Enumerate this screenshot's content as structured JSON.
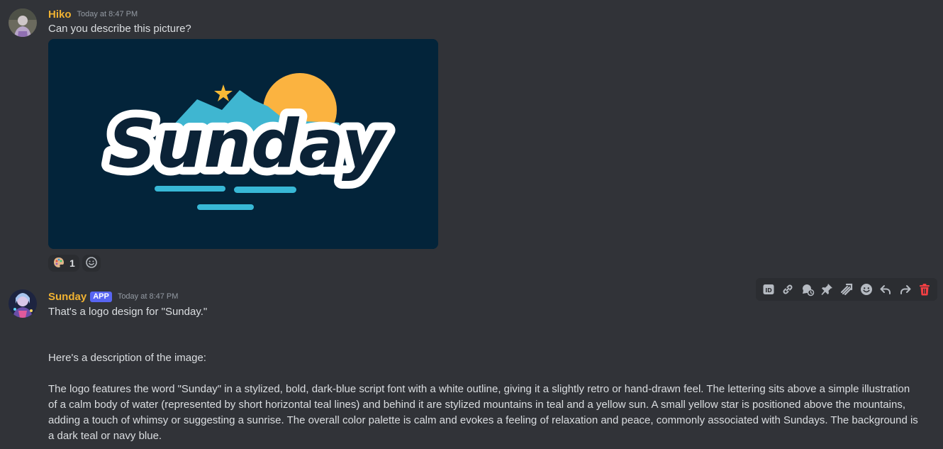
{
  "messages": [
    {
      "author": "Hiko",
      "timestamp": "Today at 8:47 PM",
      "text": "Can you describe this picture?",
      "attachment": {
        "word": "Sunday",
        "colors": {
          "background": "#03243a",
          "sun": "#fbb340",
          "mountain": "#3fb6d1",
          "star": "#f5b936",
          "water": "#38b8d6",
          "letter": "#0b2236",
          "outline": "#ffffff"
        }
      },
      "reactions": [
        {
          "emoji": "palette-icon",
          "count": "1"
        }
      ]
    },
    {
      "author": "Sunday",
      "badge": "APP",
      "timestamp": "Today at 8:47 PM",
      "lines": [
        "That's a logo design for \"Sunday.\"",
        "Here's a description of the image:",
        "The logo features the word \"Sunday\" in a stylized, bold, dark-blue script font with a white outline, giving it a slightly retro or hand-drawn feel. The lettering sits above a simple illustration of a calm body of water (represented by short horizontal teal lines) and behind it are stylized mountains in teal and a yellow sun. A small yellow star is positioned above the mountains, adding a touch of whimsy or suggesting a sunrise. The overall color palette is calm and evokes a feeling of relaxation and peace, commonly associated with Sundays. The background is a dark teal or navy blue."
      ]
    }
  ],
  "toolbar": {
    "icons": [
      "id-icon",
      "link-icon",
      "thread-icon",
      "pin-icon",
      "forward-list-icon",
      "emoji-icon",
      "reply-icon",
      "forward-icon",
      "trash-icon"
    ]
  },
  "theme": {
    "background": "#313338",
    "author_color": "#f0b232",
    "badge_color": "#5865f2",
    "danger": "#f23f43"
  }
}
